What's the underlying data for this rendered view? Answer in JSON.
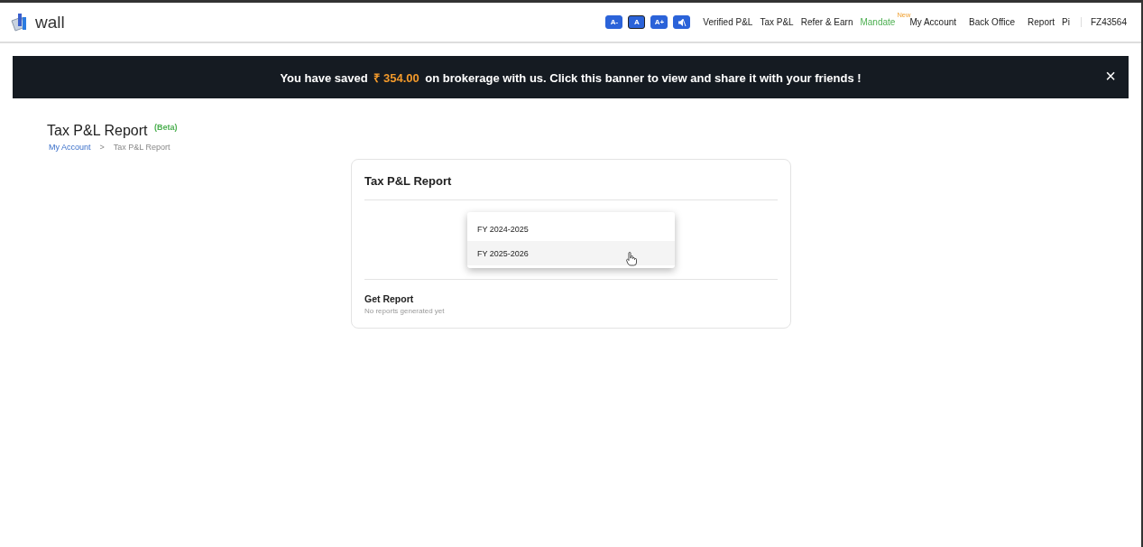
{
  "header": {
    "logo_text": "wall",
    "font_buttons": [
      {
        "label": "A-",
        "kind": "text",
        "selected": false
      },
      {
        "label": "A",
        "kind": "text",
        "selected": true
      },
      {
        "label": "A+",
        "kind": "text",
        "selected": false
      },
      {
        "kind": "mute",
        "selected": false
      }
    ],
    "nav": [
      {
        "label": "Verified P&L"
      },
      {
        "label": "Tax P&L"
      },
      {
        "label": "Refer & Earn"
      },
      {
        "label": "Mandate",
        "badge": "New",
        "highlight": true
      },
      {
        "label": "My Account"
      },
      {
        "label": "Back Office"
      },
      {
        "label": "Report"
      },
      {
        "label": "Pi"
      }
    ],
    "client_id": "FZ43564"
  },
  "banner": {
    "before": "You have saved",
    "amount": "₹ 354.00",
    "after": "on brokerage with us. Click this banner to view and share it with your friends !",
    "close": "×"
  },
  "page": {
    "title": "Tax P&L Report",
    "title_badge": "(Beta)",
    "breadcrumb": [
      {
        "label": "My Account",
        "link": true
      },
      {
        "label": "Tax P&L Report",
        "link": false
      }
    ],
    "separator": ">"
  },
  "card": {
    "title": "Tax P&L Report",
    "options": [
      {
        "label": "FY 2024-2025",
        "selected": false
      },
      {
        "label": "FY 2025-2026",
        "selected": true
      }
    ],
    "section_title": "Get Report",
    "section_note": "No reports generated yet"
  }
}
